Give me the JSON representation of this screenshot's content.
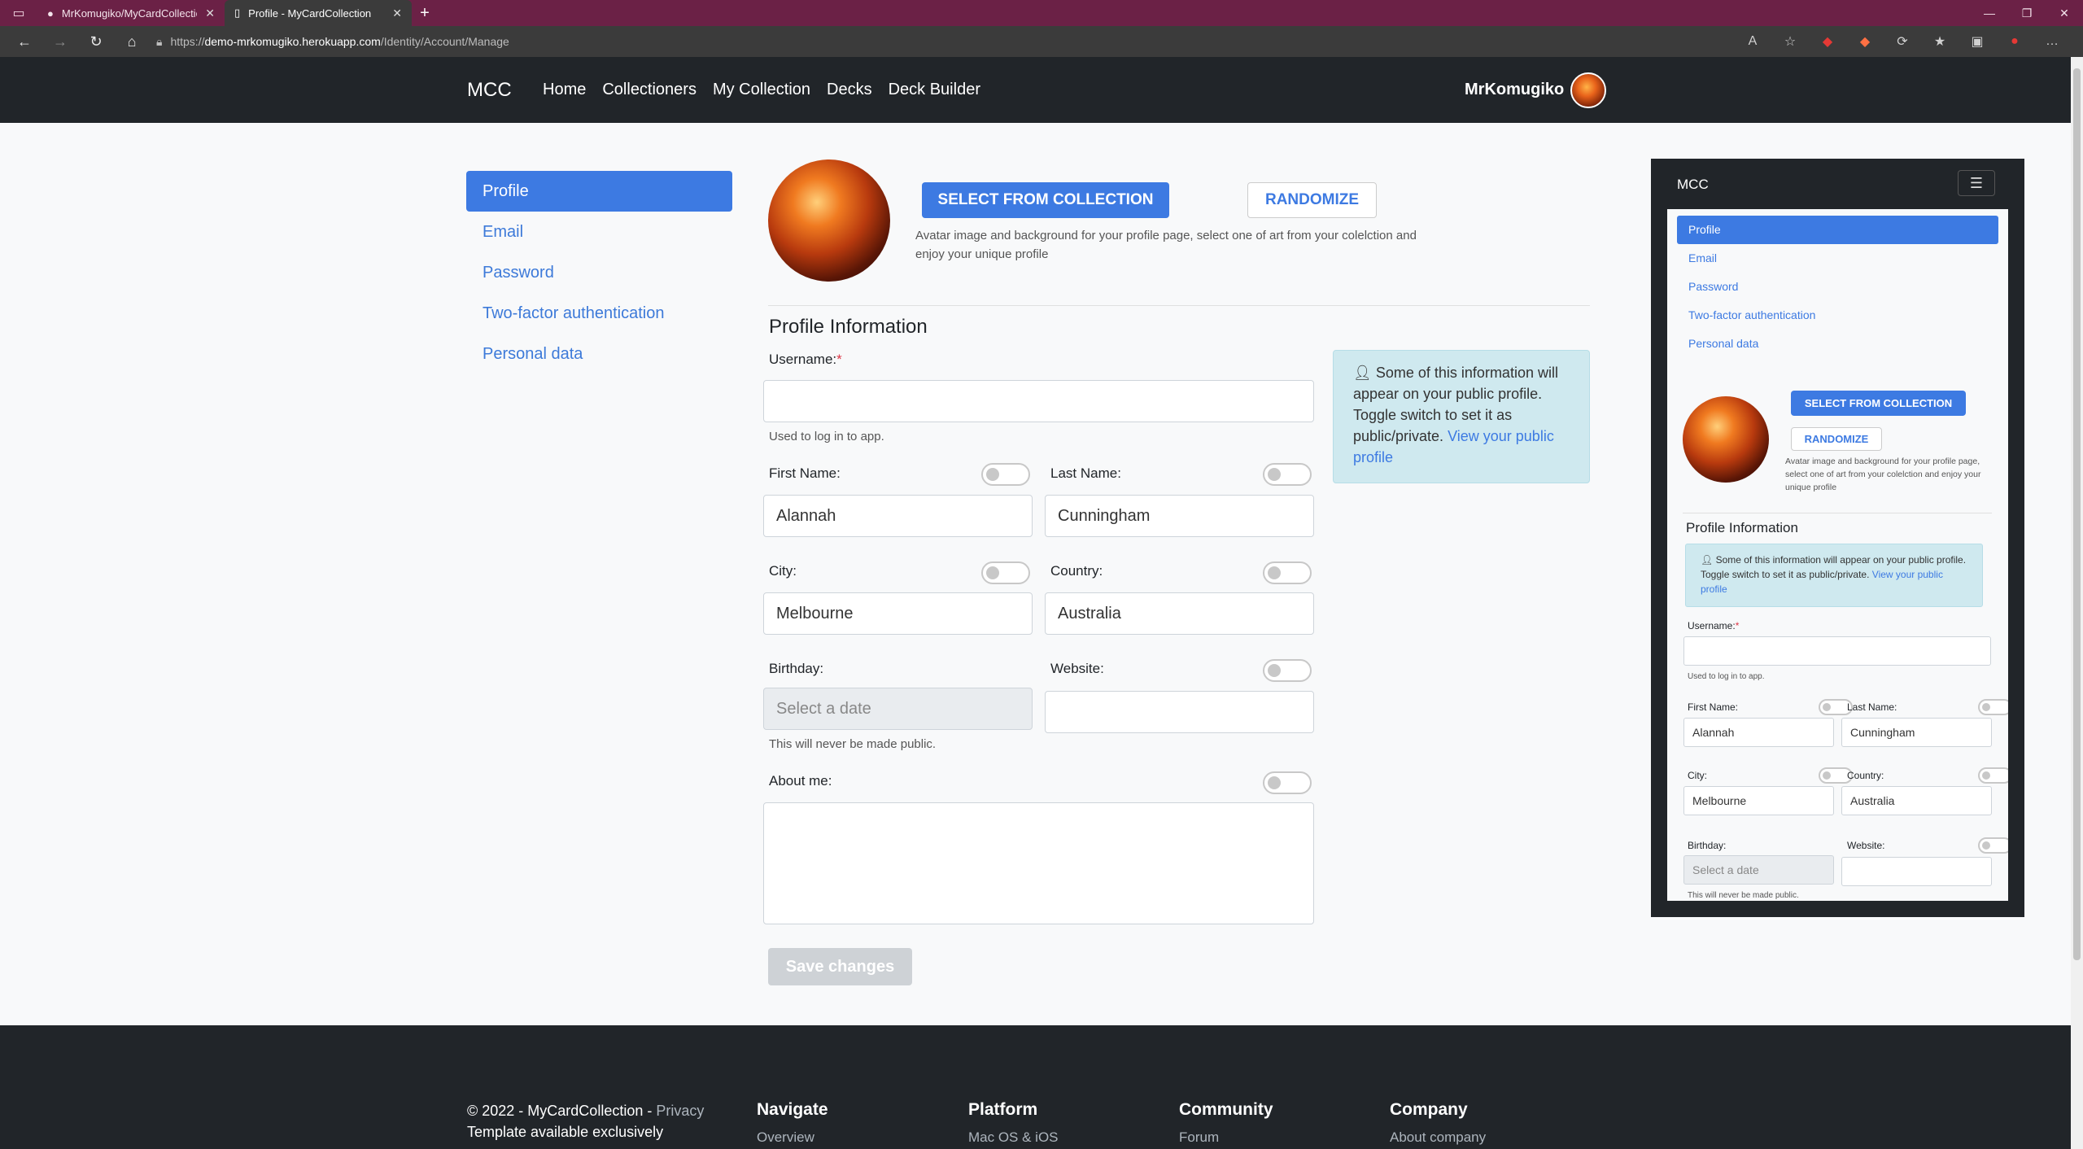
{
  "browser": {
    "tabs": [
      {
        "title": "MrKomugiko/MyCardCollection",
        "active": false
      },
      {
        "title": "Profile - MyCardCollection",
        "active": true
      }
    ],
    "url_prefix": "https://",
    "url_host": "demo-mrkomugiko.herokuapp.com",
    "url_path": "/Identity/Account/Manage"
  },
  "navbar": {
    "brand": "MCC",
    "links": [
      "Home",
      "Collectioners",
      "My Collection",
      "Decks",
      "Deck Builder"
    ],
    "username": "MrKomugiko"
  },
  "sidebar": {
    "items": [
      {
        "label": "Profile",
        "active": true
      },
      {
        "label": "Email",
        "active": false
      },
      {
        "label": "Password",
        "active": false
      },
      {
        "label": "Two-factor authentication",
        "active": false
      },
      {
        "label": "Personal data",
        "active": false
      }
    ]
  },
  "avatar": {
    "select_label": "SELECT FROM COLLECTION",
    "randomize_label": "RANDOMIZE",
    "description": "Avatar image and background for your profile page, select one of art from your colelction and enjoy your unique profile"
  },
  "profile": {
    "section_title": "Profile Information",
    "username_label": "Username:",
    "required_mark": "*",
    "username_value": "",
    "username_help": "Used to log in to app.",
    "first_name_label": "First Name:",
    "first_name_value": "Alannah",
    "last_name_label": "Last Name:",
    "last_name_value": "Cunningham",
    "city_label": "City:",
    "city_value": "Melbourne",
    "country_label": "Country:",
    "country_value": "Australia",
    "birthday_label": "Birthday:",
    "birthday_placeholder": "Select a date",
    "birthday_help": "This will never be made public.",
    "website_label": "Website:",
    "website_value": "",
    "about_label": "About me:",
    "about_value": "",
    "save_label": "Save changes"
  },
  "info_box": {
    "text": "Some of this information will appear on your public profile. Toggle switch to set it as public/private.",
    "link": "View your public profile"
  },
  "footer": {
    "copyright": "© 2022 - MyCardCollection -",
    "privacy": "Privacy",
    "template_line": "Template available exclusively",
    "columns": [
      {
        "title": "Navigate",
        "first": "Overview"
      },
      {
        "title": "Platform",
        "first": "Mac OS & iOS"
      },
      {
        "title": "Community",
        "first": "Forum"
      },
      {
        "title": "Company",
        "first": "About company"
      }
    ]
  },
  "icons": {
    "user": "person-icon",
    "hamburger": "menu-icon"
  },
  "colors": {
    "primary": "#3d7ae2",
    "navbar": "#212529",
    "info_bg": "#cfe9ef",
    "tabbar": "#6b2146"
  }
}
